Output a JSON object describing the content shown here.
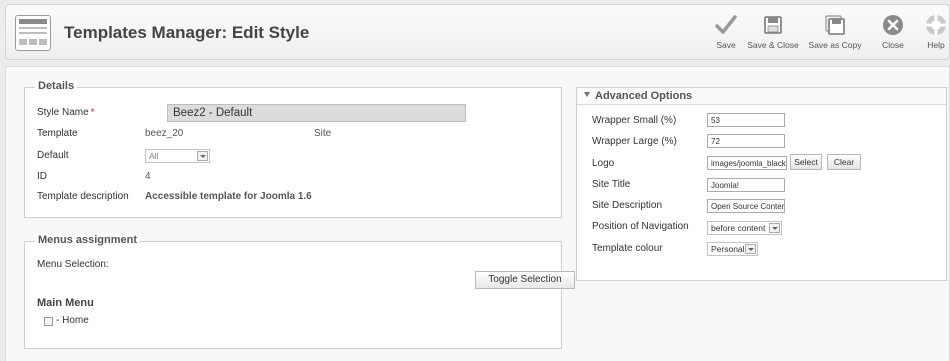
{
  "header": {
    "title": "Templates Manager: Edit Style",
    "toolbar": {
      "save": "Save",
      "save_close": "Save & Close",
      "save_copy": "Save as Copy",
      "close": "Close",
      "help": "Help"
    }
  },
  "details": {
    "legend": "Details",
    "style_name_label": "Style Name",
    "required_mark": "*",
    "style_name_value": "Beez2 - Default",
    "template_label": "Template",
    "template_value": "beez_20",
    "template_client": "Site",
    "default_label": "Default",
    "default_value": "All",
    "id_label": "ID",
    "id_value": "4",
    "description_label": "Template description",
    "description_value": "Accessible template for Joomla 1.6"
  },
  "menus": {
    "legend": "Menus assignment",
    "selection_label": "Menu Selection:",
    "toggle_label": "Toggle Selection",
    "menu_title": "Main Menu",
    "items": [
      {
        "label": "- Home"
      }
    ]
  },
  "advanced": {
    "title": "Advanced Options",
    "wrapper_small_label": "Wrapper Small (%)",
    "wrapper_small_value": "53",
    "wrapper_large_label": "Wrapper Large (%)",
    "wrapper_large_value": "72",
    "logo_label": "Logo",
    "logo_value": "images/joomla_black",
    "select_label": "Select",
    "clear_label": "Clear",
    "site_title_label": "Site Title",
    "site_title_value": "Joomla!",
    "site_description_label": "Site Description",
    "site_description_value": "Open Source Conter",
    "nav_position_label": "Position of Navigation",
    "nav_position_value": "before content",
    "colour_label": "Template colour",
    "colour_value": "Personal"
  },
  "colors": {
    "background": "#ececec",
    "required": "#cc0000"
  }
}
